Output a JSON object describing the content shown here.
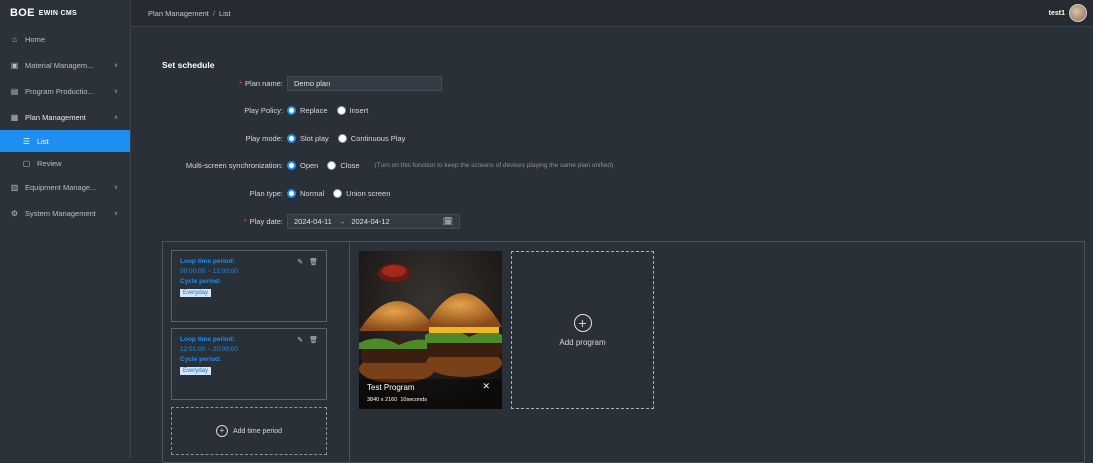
{
  "brand": {
    "logo": "BOE",
    "product": "EWIN CMS"
  },
  "sidebar": {
    "items": [
      {
        "label": "Home",
        "icon": "home-icon"
      },
      {
        "label": "Material Managem...",
        "icon": "image-icon"
      },
      {
        "label": "Program Productio...",
        "icon": "monitor-icon"
      },
      {
        "label": "Plan Management",
        "icon": "calendar-icon"
      },
      {
        "label": "List",
        "icon": "list-icon"
      },
      {
        "label": "Review",
        "icon": "review-icon"
      },
      {
        "label": "Equipment Manage...",
        "icon": "equipment-icon"
      },
      {
        "label": "System Management",
        "icon": "gear-icon"
      }
    ]
  },
  "header": {
    "breadcrumb": [
      "Plan Management",
      "List"
    ],
    "breadcrumb_sep": "/",
    "user": "test1"
  },
  "form": {
    "title": "Set schedule",
    "plan_name_label": "Plan name:",
    "plan_name_value": "Demo plan",
    "play_policy_label": "Play Policy:",
    "play_policy_options": [
      "Replace",
      "Insert"
    ],
    "play_mode_label": "Play mode:",
    "play_mode_options": [
      "Slot play",
      "Continuous Play"
    ],
    "sync_label": "Multi-screen synchronization:",
    "sync_options": [
      "Open",
      "Close"
    ],
    "sync_hint": "(Turn on this function to keep the screens of devices playing the same plan unified)",
    "plan_type_label": "Plan type:",
    "plan_type_options": [
      "Normal",
      "Union screen"
    ],
    "play_date_label": "Play date:",
    "play_date_start": "2024-04-11",
    "play_date_arrow": "→",
    "play_date_end": "2024-04-12",
    "required_mark": "*"
  },
  "periods": [
    {
      "loop_label": "Loop time period:",
      "loop_value": "00:00:00 ~ 12:00:00",
      "cycle_label": "Cycle period:",
      "cycle_value": "Everyday"
    },
    {
      "loop_label": "Loop time period:",
      "loop_value": "12:01:00 ~ 20:00:00",
      "cycle_label": "Cycle period:",
      "cycle_value": "Everyday"
    }
  ],
  "add_period_label": "Add time period",
  "program": {
    "name": "Test Program",
    "resolution": "3840 x 2160",
    "duration": "10seconds"
  },
  "add_program_label": "Add program",
  "colors": {
    "accent": "#1f8ef1",
    "bg": "#2a3038",
    "required": "#f5543c"
  }
}
